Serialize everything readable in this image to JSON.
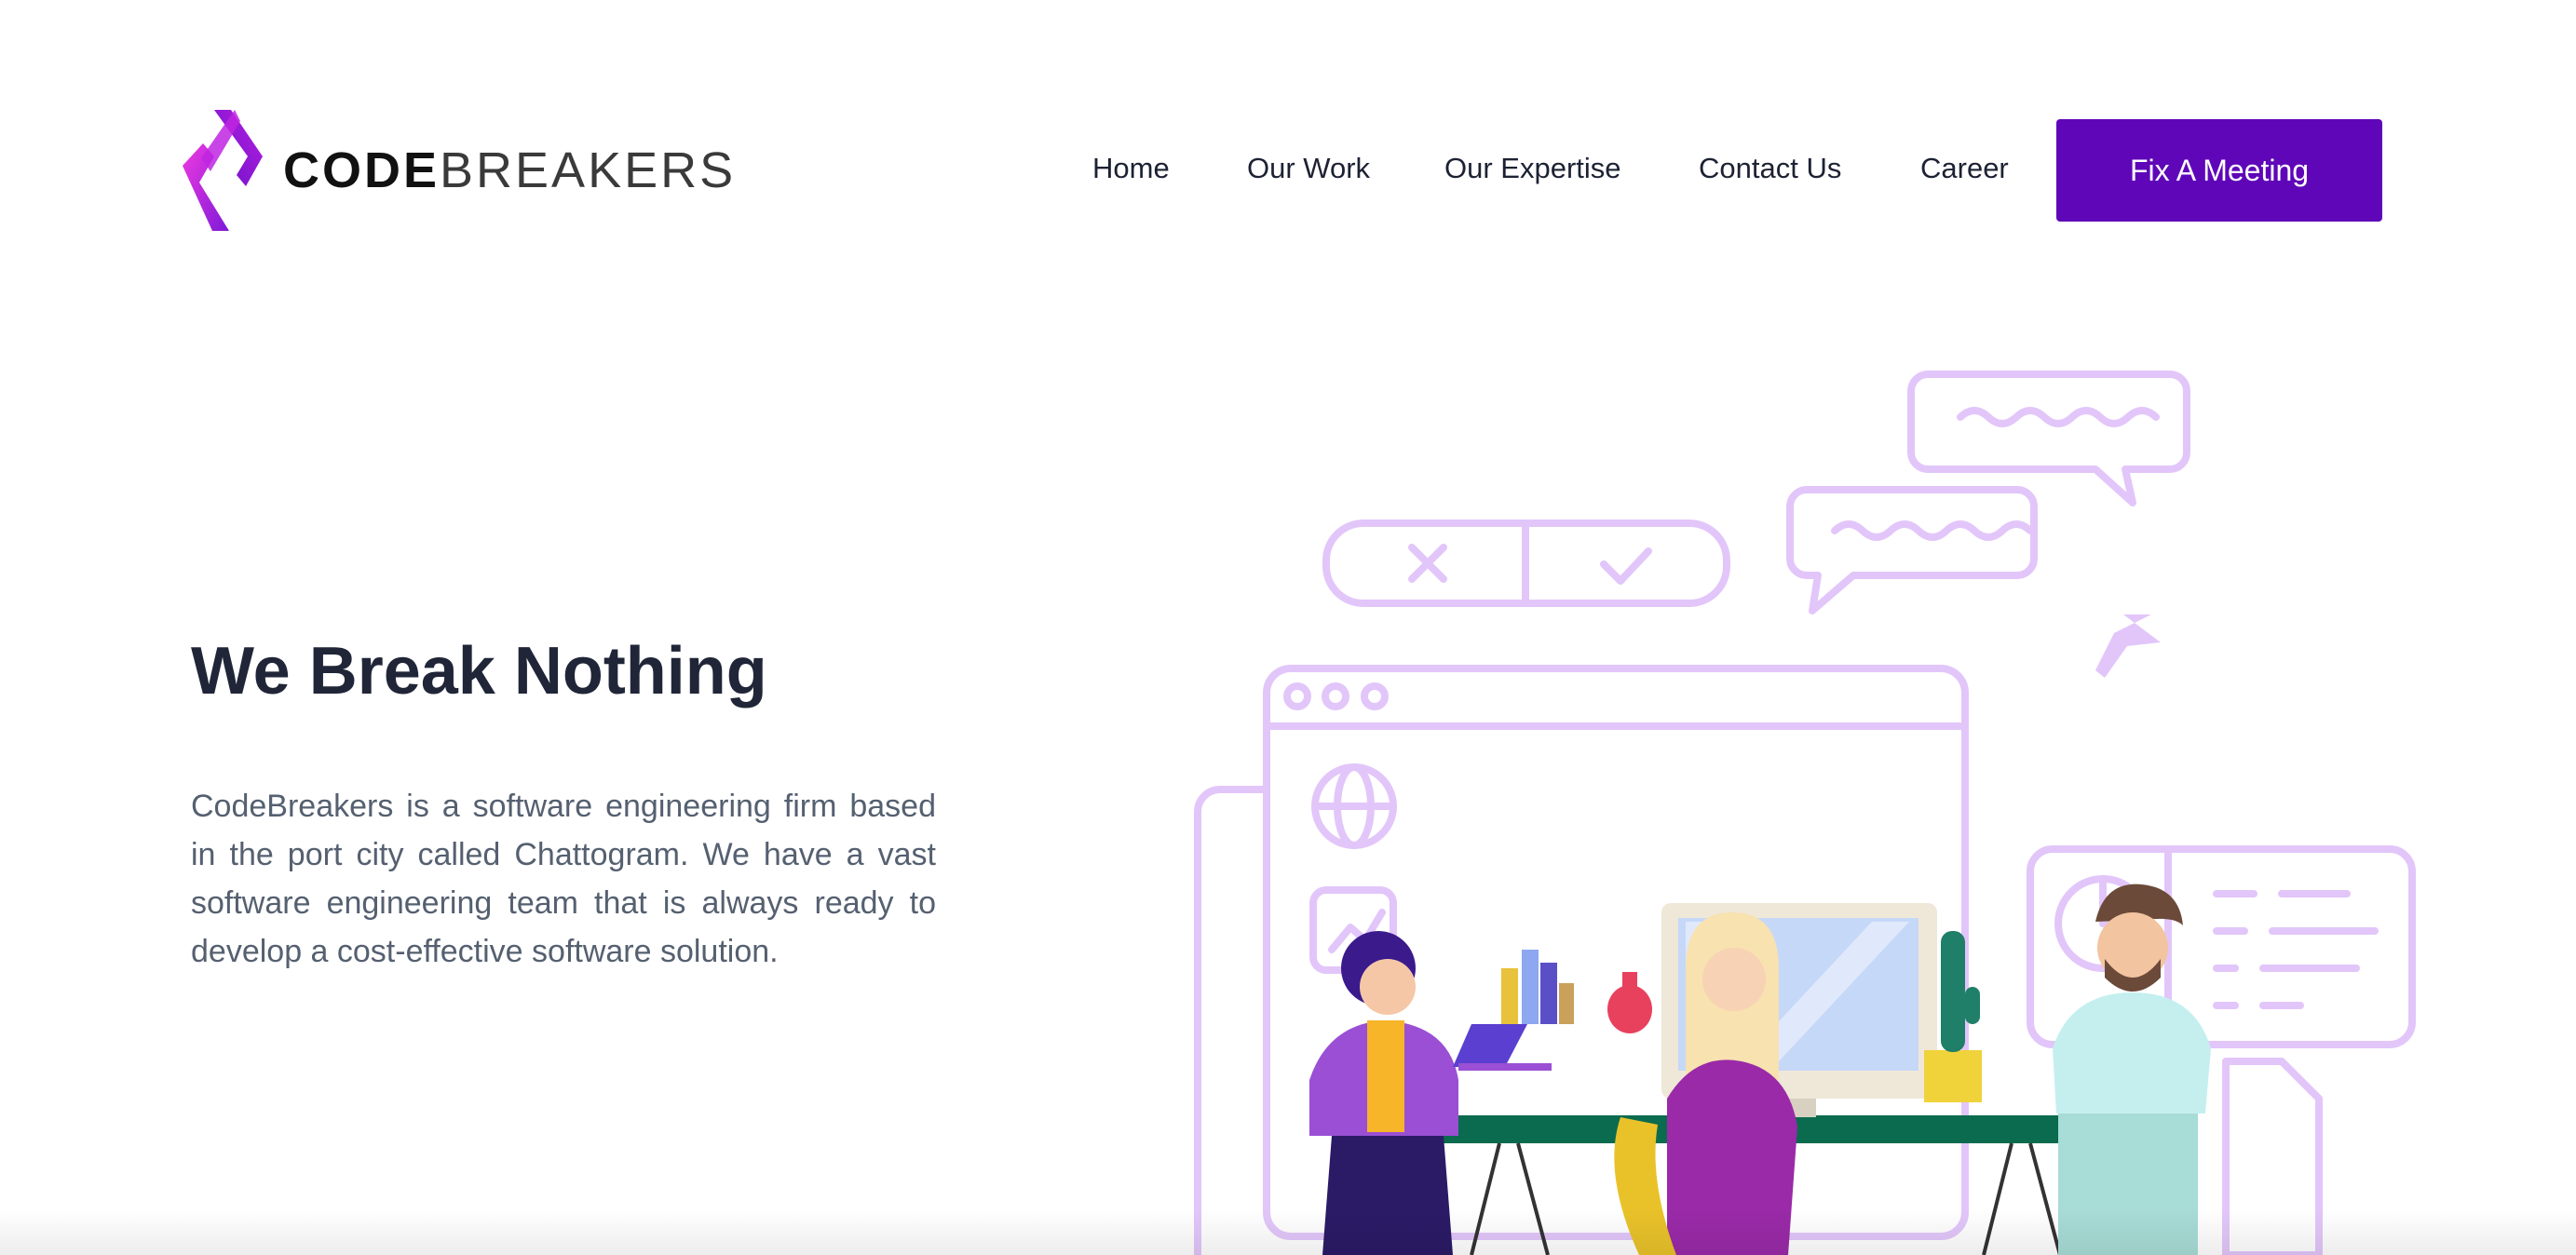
{
  "brand": {
    "name_bold": "CODE",
    "name_light": "BREAKERS",
    "logo_icon": "code-chevron-logo",
    "colors": {
      "logo_gradient_start": "#e12ad8",
      "logo_gradient_end": "#7a18d6",
      "accent": "#5f07b8"
    }
  },
  "nav": {
    "items": [
      {
        "label": "Home"
      },
      {
        "label": "Our Work"
      },
      {
        "label": "Our Expertise"
      },
      {
        "label": "Contact Us"
      },
      {
        "label": "Career"
      }
    ],
    "cta_label": "Fix A Meeting"
  },
  "hero": {
    "title": "We Break Nothing",
    "description": "CodeBreakers is a software engineering firm based in the port city called Chattogram. We have a vast software engineering team that is always ready to develop a cost-effective software solution."
  },
  "illustration": {
    "subject": "team-collaboration-illustration",
    "line_color": "#e2c6fa"
  }
}
